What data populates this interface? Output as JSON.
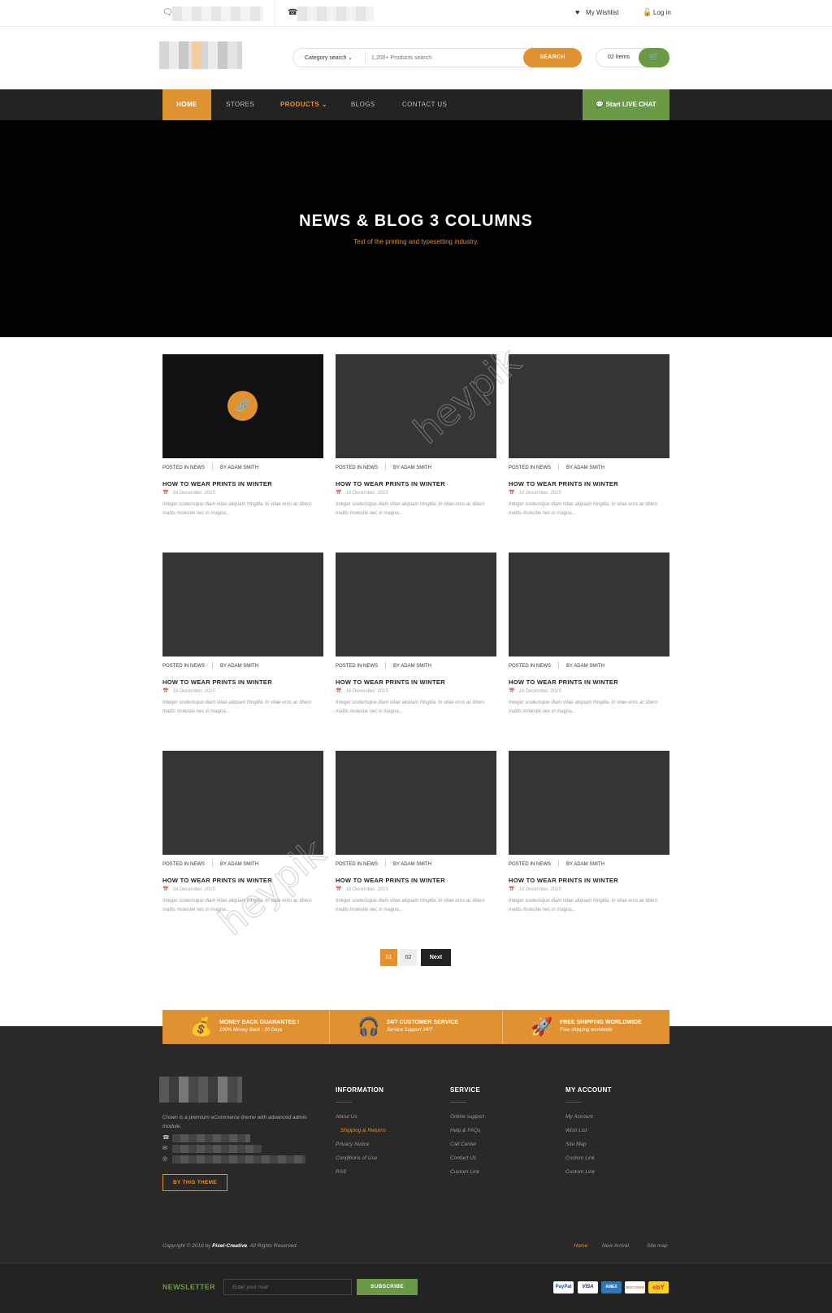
{
  "topbar": {
    "wishlist": "My Wishlist",
    "login": "Log in"
  },
  "header": {
    "search": {
      "category": "Category search",
      "placeholder": "1,200+ Products search",
      "button": "SEARCH"
    },
    "cart": {
      "count": "02 Items"
    }
  },
  "nav": {
    "items": [
      "HOME",
      "STORES",
      "PRODUCTS",
      "BLOGS",
      "CONTACT US"
    ],
    "chat": "Start LIVE CHAT"
  },
  "hero": {
    "title": "NEWS & BLOG 3 COLUMNS",
    "subtitle": "Text of the printing and typesetting industry."
  },
  "posts": [
    {
      "category": "POSTED IN NEWS",
      "author": "BY ADAM SMITH",
      "title": "HOW TO WEAR PRINTS IN WINTER",
      "date": "16 December, 2015",
      "excerpt": "Integer scelerisque diam vitae aliquam fringilla. In vitae eros ac libero mattis molestie nec in magna..."
    },
    {
      "category": "POSTED IN NEWS",
      "author": "BY ADAM SMITH",
      "title": "HOW TO WEAR PRINTS IN WINTER",
      "date": "16 December, 2015",
      "excerpt": "Integer scelerisque diam vitae aliquam fringilla. In vitae eros ac libero mattis molestie nec in magna..."
    },
    {
      "category": "POSTED IN NEWS",
      "author": "BY ADAM SMITH",
      "title": "HOW TO WEAR PRINTS IN WINTER",
      "date": "16 December, 2015",
      "excerpt": "Integer scelerisque diam vitae aliquam fringilla. In vitae eros ac libero mattis molestie nec in magna..."
    },
    {
      "category": "POSTED IN NEWS",
      "author": "BY ADAM SMITH",
      "title": "HOW TO WEAR PRINTS IN WINTER",
      "date": "16 December, 2015",
      "excerpt": "Integer scelerisque diam vitae aliquam fringilla. In vitae eros ac libero mattis molestie nec in magna..."
    },
    {
      "category": "POSTED IN NEWS",
      "author": "BY ADAM SMITH",
      "title": "HOW TO WEAR PRINTS IN WINTER",
      "date": "16 December, 2015",
      "excerpt": "Integer scelerisque diam vitae aliquam fringilla. In vitae eros ac libero mattis molestie nec in magna..."
    },
    {
      "category": "POSTED IN NEWS",
      "author": "BY ADAM SMITH",
      "title": "HOW TO WEAR PRINTS IN WINTER",
      "date": "16 December, 2015",
      "excerpt": "Integer scelerisque diam vitae aliquam fringilla. In vitae eros ac libero mattis molestie nec in magna..."
    },
    {
      "category": "POSTED IN NEWS",
      "author": "BY ADAM SMITH",
      "title": "HOW TO WEAR PRINTS IN WINTER",
      "date": "16 December, 2015",
      "excerpt": "Integer scelerisque diam vitae aliquam fringilla. In vitae eros ac libero mattis molestie nec in magna..."
    },
    {
      "category": "POSTED IN NEWS",
      "author": "BY ADAM SMITH",
      "title": "HOW TO WEAR PRINTS IN WINTER",
      "date": "16 December, 2015",
      "excerpt": "Integer scelerisque diam vitae aliquam fringilla. In vitae eros ac libero mattis molestie nec in magna..."
    },
    {
      "category": "POSTED IN NEWS",
      "author": "BY ADAM SMITH",
      "title": "HOW TO WEAR PRINTS IN WINTER",
      "date": "16 December, 2015",
      "excerpt": "Integer scelerisque diam vitae aliquam fringilla. In vitae eros ac libero mattis molestie nec in magna..."
    }
  ],
  "pagination": {
    "pages": [
      "01",
      "02"
    ],
    "next": "Next"
  },
  "features": [
    {
      "title": "MONEY BACK GUARANTEE !",
      "subtitle": "100% Money Back - 30 Days",
      "icon": "money-bag-icon"
    },
    {
      "title": "24/7 CUSTOMER SERVICE",
      "subtitle": "Service Support 24/7",
      "icon": "headset-icon"
    },
    {
      "title": "FREE SHIPPING WORLDWIDE",
      "subtitle": "Free shipping worldwide",
      "icon": "rocket-icon"
    }
  ],
  "footer": {
    "description": "Crown is a premium eCommerce theme with advanced admin module.",
    "by_theme": "BY THIS THEME",
    "columns": [
      {
        "title": "INFORMATION",
        "links": [
          "About Us",
          "Shipping & Returns",
          "Privacy Notice",
          "Conditions of Use",
          "RSS"
        ]
      },
      {
        "title": "SERVICE",
        "links": [
          "Online support",
          "Help & FAQs",
          "Call Center",
          "Contact Us",
          "Custom Link"
        ]
      },
      {
        "title": "MY ACCOUNT",
        "links": [
          "My Account",
          "Wish List",
          "Site Map",
          "Custom Link",
          "Custom Link"
        ]
      }
    ],
    "copyright_prefix": "Copyright © 2016 by ",
    "copyright_brand": "Pixel-Creative",
    "copyright_suffix": ". All Rights Reserved.",
    "bottom_links": [
      "Home",
      "New Arrival",
      "Site map"
    ]
  },
  "newsletter": {
    "label": "NEWSLETTER",
    "placeholder": "Enter your mail",
    "button": "SUBSCRIBE"
  },
  "payments": [
    "PayPal",
    "VISA",
    "AMEX",
    "DISCOVER",
    "ebY"
  ],
  "watermark": "heypik",
  "colors": {
    "accent": "#e09232",
    "green": "#6a9a45",
    "dark": "#222222",
    "footer": "#2b2828"
  }
}
